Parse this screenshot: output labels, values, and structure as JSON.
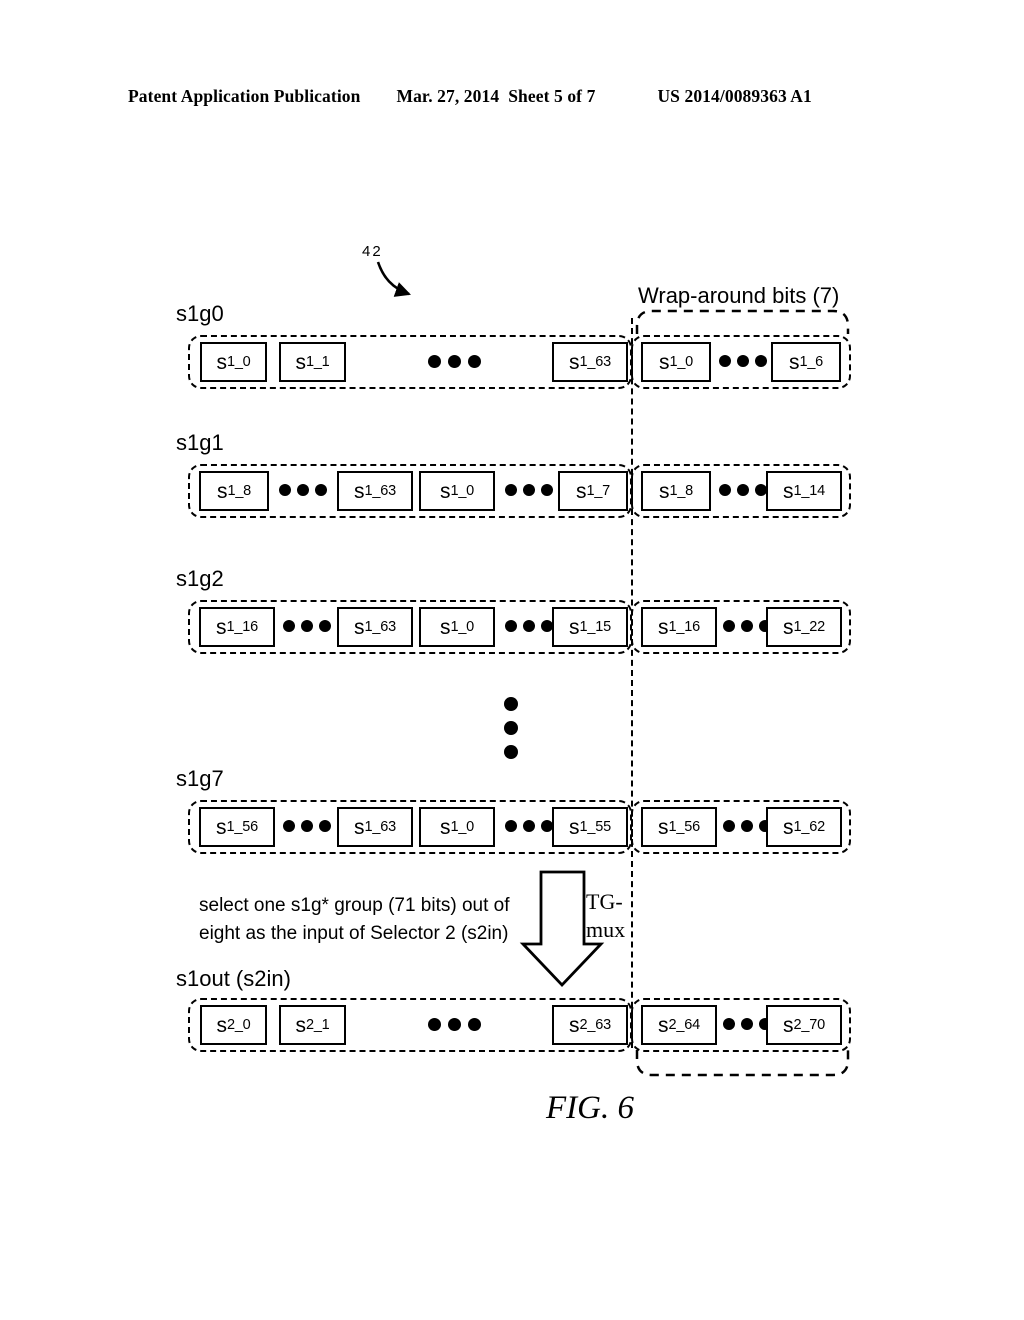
{
  "header": {
    "publication": "Patent Application Publication",
    "date": "Mar. 27, 2014",
    "sheet": "Sheet 5 of 7",
    "patent_number": "US 2014/0089363 A1"
  },
  "figure": {
    "reference_numeral": "42",
    "wrap_around_label": "Wrap-around bits (7)",
    "caption": "select one s1g* group (71 bits) out of\neight as the input of Selector 2 (s2in)",
    "mux_label": "TG-\nmux",
    "fig_caption": "FIG. 6",
    "vertical_ellipsis": "vertical-ellipsis",
    "rows": [
      {
        "label": "s1g0",
        "main_cells": [
          "s1_0",
          "s1_1",
          "s1_63"
        ],
        "main_layout": [
          "cell",
          "cell",
          "dots",
          "cell"
        ],
        "wrap_cells": [
          "s1_0",
          "s1_6"
        ],
        "wrap_layout": [
          "cell",
          "dots",
          "cell"
        ]
      },
      {
        "label": "s1g1",
        "main_cells": [
          "s1_8",
          "s1_63",
          "s1_0",
          "s1_7"
        ],
        "main_layout": [
          "cell",
          "dots",
          "cell",
          "cell",
          "dots",
          "cell"
        ],
        "wrap_cells": [
          "s1_8",
          "s1_14"
        ],
        "wrap_layout": [
          "cell",
          "dots",
          "cell"
        ]
      },
      {
        "label": "s1g2",
        "main_cells": [
          "s1_16",
          "s1_63",
          "s1_0",
          "s1_15"
        ],
        "main_layout": [
          "cell",
          "dots",
          "cell",
          "cell",
          "dots",
          "cell"
        ],
        "wrap_cells": [
          "s1_16",
          "s1_22"
        ],
        "wrap_layout": [
          "cell",
          "dots",
          "cell"
        ]
      },
      {
        "label": "s1g7",
        "main_cells": [
          "s1_56",
          "s1_63",
          "s1_0",
          "s1_55"
        ],
        "main_layout": [
          "cell",
          "dots",
          "cell",
          "cell",
          "dots",
          "cell"
        ],
        "wrap_cells": [
          "s1_56",
          "s1_62"
        ],
        "wrap_layout": [
          "cell",
          "dots",
          "cell"
        ]
      },
      {
        "label": "s1out (s2in)",
        "main_cells": [
          "s2_0",
          "s2_1",
          "s2_63"
        ],
        "main_layout": [
          "cell",
          "cell",
          "dots",
          "cell"
        ],
        "wrap_cells": [
          "s2_64",
          "s2_70"
        ],
        "wrap_layout": [
          "cell",
          "dots",
          "cell"
        ]
      }
    ],
    "cells": {
      "r0_c0_base": "s",
      "r0_c0_sub": "1_0",
      "r0_c1_base": "s",
      "r0_c1_sub": "1_1",
      "r0_c2_base": "s",
      "r0_c2_sub": "1_63",
      "r0_w0_base": "s",
      "r0_w0_sub": "1_0",
      "r0_w1_base": "s",
      "r0_w1_sub": "1_6",
      "r1_c0_base": "s",
      "r1_c0_sub": "1_8",
      "r1_c1_base": "s",
      "r1_c1_sub": "1_63",
      "r1_c2_base": "s",
      "r1_c2_sub": "1_0",
      "r1_c3_base": "s",
      "r1_c3_sub": "1_7",
      "r1_w0_base": "s",
      "r1_w0_sub": "1_8",
      "r1_w1_base": "s",
      "r1_w1_sub": "1_14",
      "r2_c0_base": "s",
      "r2_c0_sub": "1_16",
      "r2_c1_base": "s",
      "r2_c1_sub": "1_63",
      "r2_c2_base": "s",
      "r2_c2_sub": "1_0",
      "r2_c3_base": "s",
      "r2_c3_sub": "1_15",
      "r2_w0_base": "s",
      "r2_w0_sub": "1_16",
      "r2_w1_base": "s",
      "r2_w1_sub": "1_22",
      "r3_c0_base": "s",
      "r3_c0_sub": "1_56",
      "r3_c1_base": "s",
      "r3_c1_sub": "1_63",
      "r3_c2_base": "s",
      "r3_c2_sub": "1_0",
      "r3_c3_base": "s",
      "r3_c3_sub": "1_55",
      "r3_w0_base": "s",
      "r3_w0_sub": "1_56",
      "r3_w1_base": "s",
      "r3_w1_sub": "1_62",
      "r4_c0_base": "s",
      "r4_c0_sub": "2_0",
      "r4_c1_base": "s",
      "r4_c1_sub": "2_1",
      "r4_c2_base": "s",
      "r4_c2_sub": "2_63",
      "r4_w0_base": "s",
      "r4_w0_sub": "2_64",
      "r4_w1_base": "s",
      "r4_w1_sub": "2_70"
    },
    "row_labels": {
      "r0": "s1g0",
      "r1": "s1g1",
      "r2": "s1g2",
      "r3": "s1g7",
      "r4": "s1out (s2in)"
    }
  }
}
